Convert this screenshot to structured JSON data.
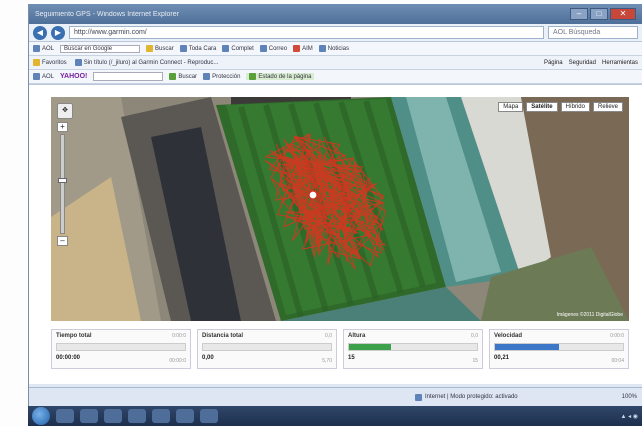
{
  "window": {
    "title": "Seguimiento GPS - Windows Internet Explorer"
  },
  "address_bar": {
    "url": "http://www.garmin.com/",
    "search_placeholder": "AOL Búsqueda"
  },
  "toolbar": {
    "search_placeholder": "Buscar en Google",
    "items": [
      "Buscar",
      "Toda Cara",
      "Complet",
      "Correo",
      "AIM",
      "Noticias"
    ]
  },
  "toolbar2": {
    "brand": "YAHOO!",
    "items": [
      "Buscar",
      "Protección",
      "Estado de la página"
    ]
  },
  "favorites_bar": {
    "favorites_label": "Favoritos",
    "tab_label": "Sin título (/_jiluro) al Garmin Connect - Reproduc...",
    "right_items": [
      "Página",
      "Seguridad",
      "Herramientas"
    ]
  },
  "map": {
    "type_buttons": [
      "Mapa",
      "Satélite",
      "Híbrido",
      "Relieve"
    ],
    "active_type": "Satélite",
    "copyright": "Imágenes ©2011 DigitalGlobe",
    "zoom_level_fraction": 0.45
  },
  "stats": [
    {
      "label": "Tiempo total",
      "max": "0:00:0",
      "value": "00:00:00",
      "value2": "00:00:0",
      "fill": 0.0,
      "color": "#9aa4b0"
    },
    {
      "label": "Distancia total",
      "max": "0,0",
      "value": "0,00",
      "value2": "5,70",
      "fill": 0.0,
      "color": "#9aa4b0"
    },
    {
      "label": "Altura",
      "max": "0,0",
      "value": "15",
      "value2": "15",
      "fill": 0.33,
      "color": "#3da04a"
    },
    {
      "label": "Velocidad",
      "max": "0:00:0",
      "value": "00,21",
      "value2": "00:04",
      "fill": 0.5,
      "color": "#3d78c8"
    }
  ],
  "status_bar": {
    "text": "Internet | Modo protegido: activado",
    "zoom": "100%"
  },
  "colors": {
    "track": "#e0301e"
  }
}
